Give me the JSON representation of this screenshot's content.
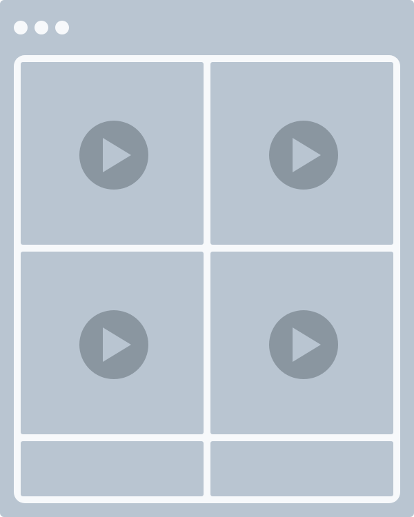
{
  "window": {
    "controls": [
      {
        "name": "window-control-1"
      },
      {
        "name": "window-control-2"
      },
      {
        "name": "window-control-3"
      }
    ]
  },
  "grid": {
    "video_tiles": [
      {
        "icon": "play-icon"
      },
      {
        "icon": "play-icon"
      },
      {
        "icon": "play-icon"
      },
      {
        "icon": "play-icon"
      }
    ],
    "caption_tiles": [
      {
        "text": ""
      },
      {
        "text": ""
      }
    ]
  },
  "colors": {
    "window_bg": "#b9c5d1",
    "frame_bg": "#f7f9fb",
    "tile_bg": "#b9c5d1",
    "play_circle": "#8a96a0",
    "play_triangle": "#b9c5d1",
    "control_dot": "#f7f9fb"
  }
}
